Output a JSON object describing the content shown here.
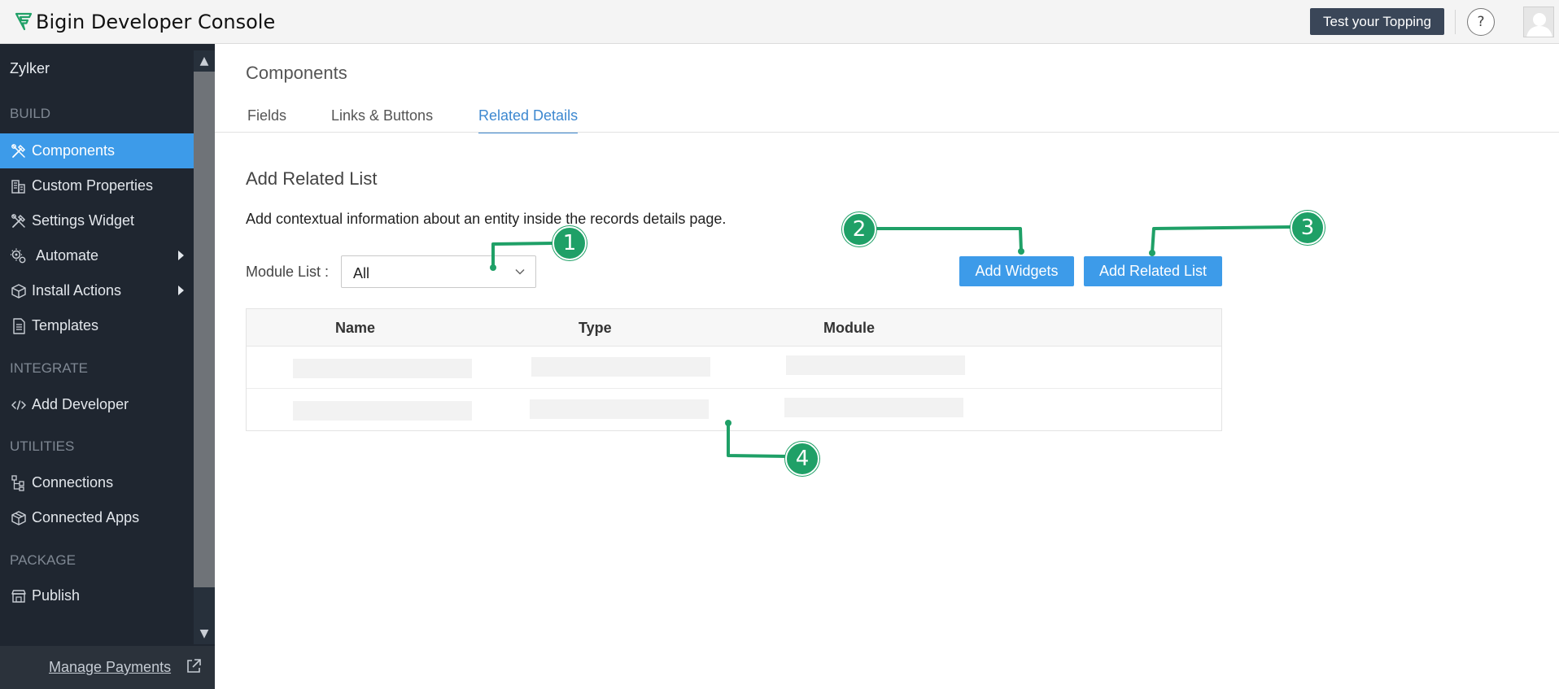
{
  "header": {
    "app_title": "Bigin Developer Console",
    "test_button": "Test your Topping",
    "help_label": "?"
  },
  "sidebar": {
    "org": "Zylker",
    "sections": {
      "build": "BUILD",
      "integrate": "INTEGRATE",
      "utilities": "UTILITIES",
      "package": "PACKAGE"
    },
    "items": {
      "components": "Components",
      "custom_properties": "Custom Properties",
      "settings_widget": "Settings Widget",
      "automate": "Automate",
      "install_actions": "Install Actions",
      "templates": "Templates",
      "add_developer": "Add Developer",
      "connections": "Connections",
      "connected_apps": "Connected Apps",
      "publish": "Publish"
    },
    "footer_link": "Manage Payments"
  },
  "main": {
    "title": "Components",
    "tabs": [
      "Fields",
      "Links & Buttons",
      "Related Details"
    ],
    "active_tab": "Related Details",
    "section_title": "Add Related List",
    "description": "Add contextual information about an entity inside the records details page.",
    "module_label": "Module List :",
    "module_value": "All",
    "add_widgets": "Add Widgets",
    "add_related_list": "Add Related List",
    "table_headers": [
      "Name",
      "Type",
      "Module"
    ]
  },
  "annotations": [
    "1",
    "2",
    "3",
    "4"
  ],
  "colors": {
    "accent": "#3d9be9",
    "sidebar": "#1f2630",
    "callout": "#1fa067",
    "top_button": "#3a4658"
  }
}
